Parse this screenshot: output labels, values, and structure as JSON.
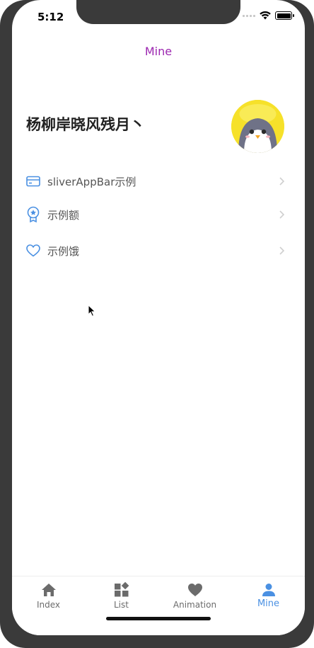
{
  "status_bar": {
    "time": "5:12"
  },
  "header": {
    "title": "Mine"
  },
  "profile": {
    "name": "杨柳岸晓风残月丶",
    "avatar": "penguin-avatar"
  },
  "menu": {
    "items": [
      {
        "label": "sliverAppBar示例",
        "icon": "card-icon"
      },
      {
        "label": "示例额",
        "icon": "award-icon"
      },
      {
        "label": "示例饿",
        "icon": "heart-outline-icon"
      }
    ]
  },
  "tabs": [
    {
      "label": "Index",
      "icon": "home-icon",
      "active": false
    },
    {
      "label": "List",
      "icon": "widgets-icon",
      "active": false
    },
    {
      "label": "Animation",
      "icon": "heart-icon",
      "active": false
    },
    {
      "label": "Mine",
      "icon": "person-icon",
      "active": true
    }
  ],
  "colors": {
    "title": "#9c27b0",
    "accent": "#4a90e2",
    "tab_inactive": "#6b6b6b",
    "avatar_bg": "#f6e12a"
  }
}
